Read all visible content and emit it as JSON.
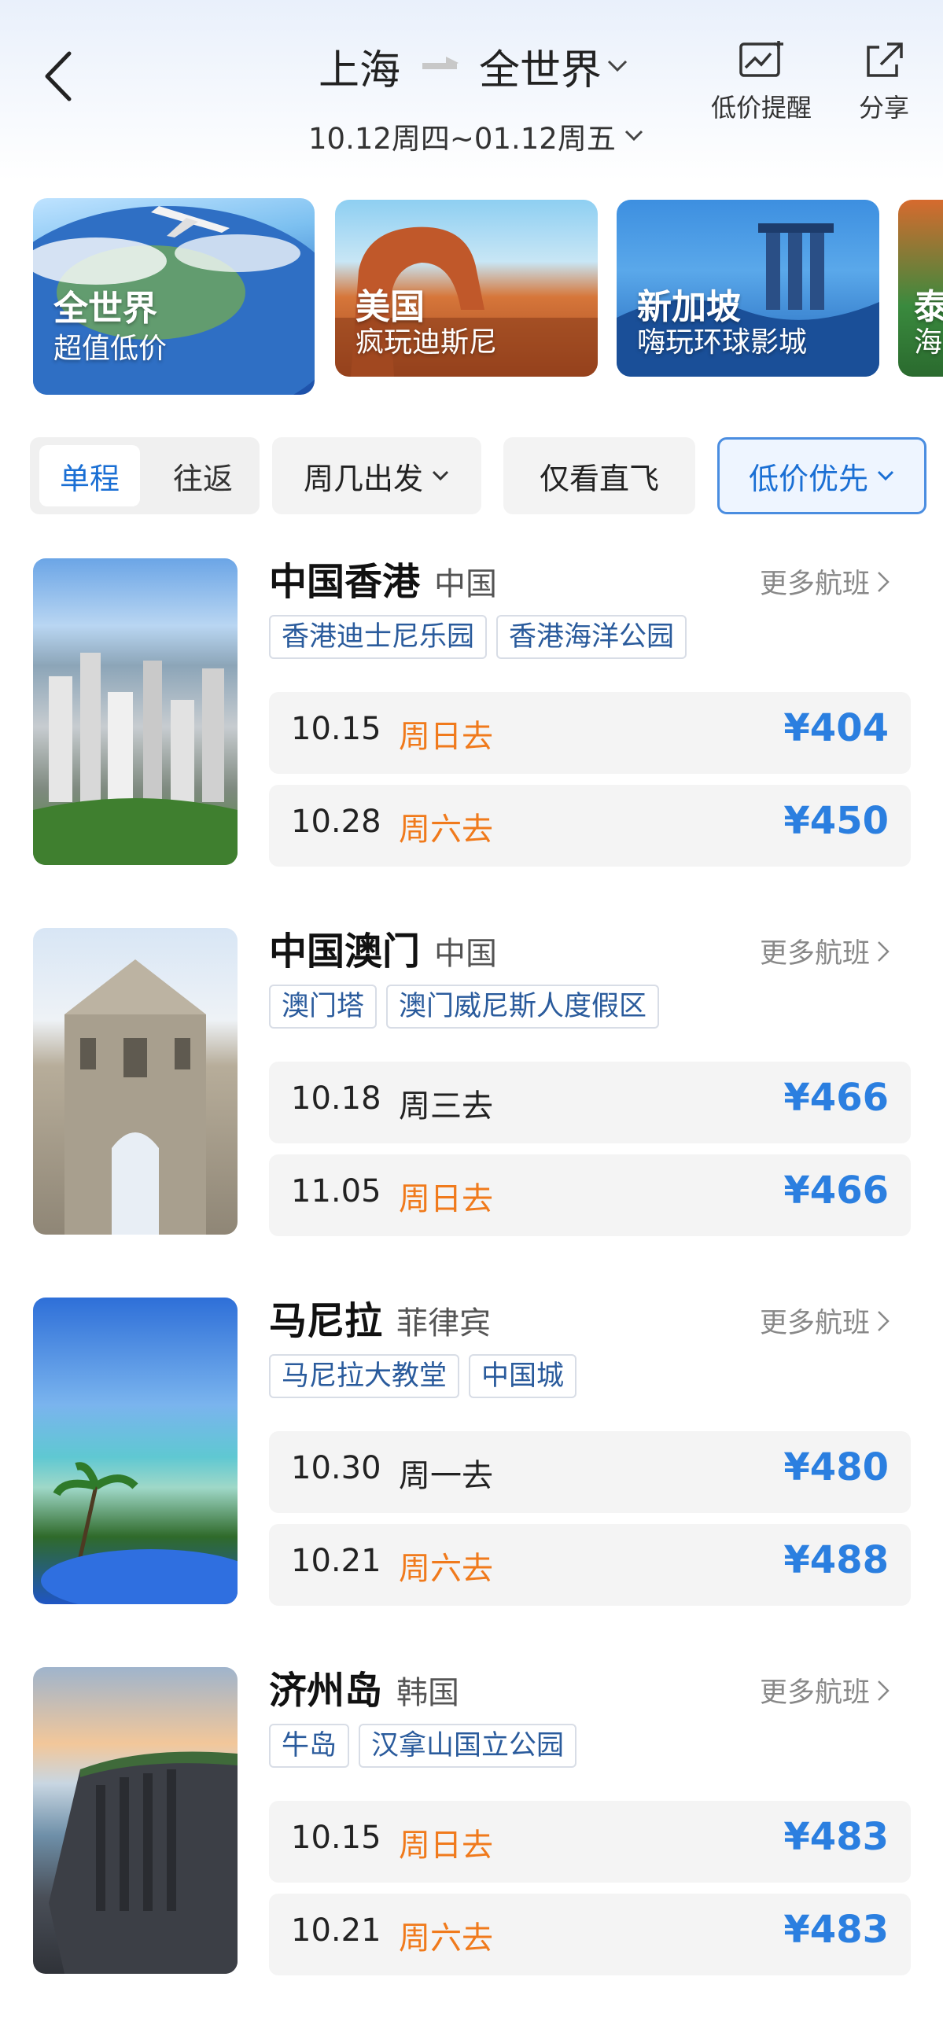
{
  "header": {
    "from_city": "上海",
    "to_city": "全世界",
    "date_range": "10.12周四~01.12周五",
    "price_alert_label": "低价提醒",
    "share_label": "分享"
  },
  "banners": [
    {
      "title": "全世界",
      "subtitle": "超值低价"
    },
    {
      "title": "美国",
      "subtitle": "疯玩迪斯尼"
    },
    {
      "title": "新加坡",
      "subtitle": "嗨玩环球影城"
    },
    {
      "title": "泰",
      "subtitle": "海"
    }
  ],
  "filters": {
    "one_way": "单程",
    "round_trip": "往返",
    "weekday": "周几出发",
    "direct_only": "仅看直飞",
    "low_price_first": "低价优先"
  },
  "destinations": [
    {
      "name": "中国香港",
      "country": "中国",
      "more": "更多航班",
      "tags": [
        "香港迪士尼乐园",
        "香港海洋公园"
      ],
      "flights": [
        {
          "date": "10.15",
          "weekday": "周日去",
          "weekend": true,
          "price": "¥404"
        },
        {
          "date": "10.28",
          "weekday": "周六去",
          "weekend": true,
          "price": "¥450"
        }
      ]
    },
    {
      "name": "中国澳门",
      "country": "中国",
      "more": "更多航班",
      "tags": [
        "澳门塔",
        "澳门威尼斯人度假区"
      ],
      "flights": [
        {
          "date": "10.18",
          "weekday": "周三去",
          "weekend": false,
          "price": "¥466"
        },
        {
          "date": "11.05",
          "weekday": "周日去",
          "weekend": true,
          "price": "¥466"
        }
      ]
    },
    {
      "name": "马尼拉",
      "country": "菲律宾",
      "more": "更多航班",
      "tags": [
        "马尼拉大教堂",
        "中国城"
      ],
      "flights": [
        {
          "date": "10.30",
          "weekday": "周一去",
          "weekend": false,
          "price": "¥480"
        },
        {
          "date": "10.21",
          "weekday": "周六去",
          "weekend": true,
          "price": "¥488"
        }
      ]
    },
    {
      "name": "济州岛",
      "country": "韩国",
      "more": "更多航班",
      "tags": [
        "牛岛",
        "汉拿山国立公园"
      ],
      "flights": [
        {
          "date": "10.15",
          "weekday": "周日去",
          "weekend": true,
          "price": "¥483"
        },
        {
          "date": "10.21",
          "weekday": "周六去",
          "weekend": true,
          "price": "¥483"
        }
      ]
    }
  ],
  "colors": {
    "accent_blue": "#2b7fe0",
    "weekend_orange": "#f07a1c",
    "tag_text": "#2a5b9c"
  }
}
